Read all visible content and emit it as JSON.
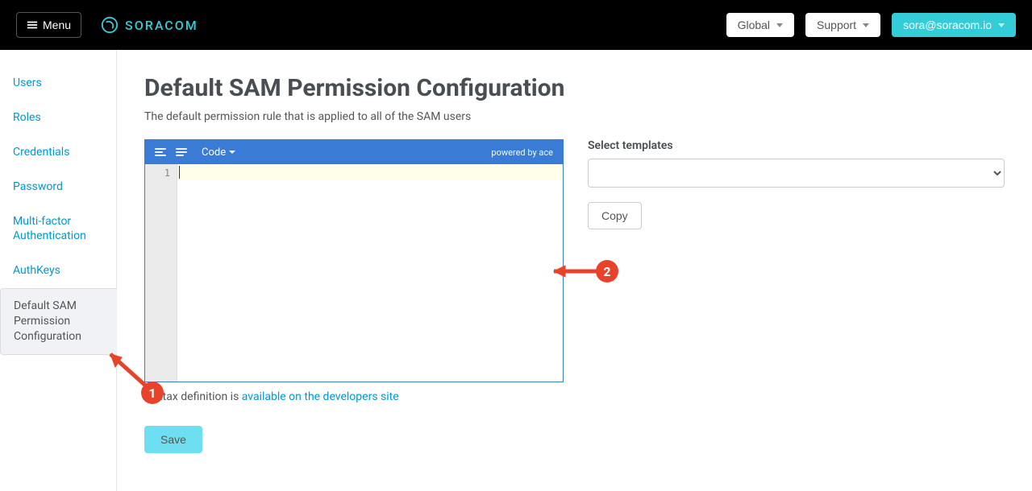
{
  "header": {
    "menu_label": "Menu",
    "brand": "SORACOM",
    "global_label": "Global",
    "support_label": "Support",
    "user_email": "sora@soracom.io"
  },
  "sidebar": {
    "items": [
      {
        "label": "Users"
      },
      {
        "label": "Roles"
      },
      {
        "label": "Credentials"
      },
      {
        "label": "Password"
      },
      {
        "label": "Multi-factor Authentication"
      },
      {
        "label": "AuthKeys"
      },
      {
        "label": "Default SAM Permission Configuration"
      }
    ]
  },
  "page": {
    "title": "Default SAM Permission Configuration",
    "subtitle": "The default permission rule that is applied to all of the SAM users",
    "syntax_prefix": "Syntax definition is ",
    "syntax_link": "available on the developers site",
    "save_label": "Save"
  },
  "editor": {
    "toolbar_code_label": "Code",
    "powered_by": "powered by ace",
    "line_number": "1"
  },
  "templates": {
    "label": "Select templates",
    "copy_label": "Copy"
  },
  "annotations": {
    "num1": "1",
    "num2": "2"
  },
  "colors": {
    "accent": "#34cdd7",
    "toolbar": "#3a7bd5",
    "annotation": "#e8422b"
  }
}
